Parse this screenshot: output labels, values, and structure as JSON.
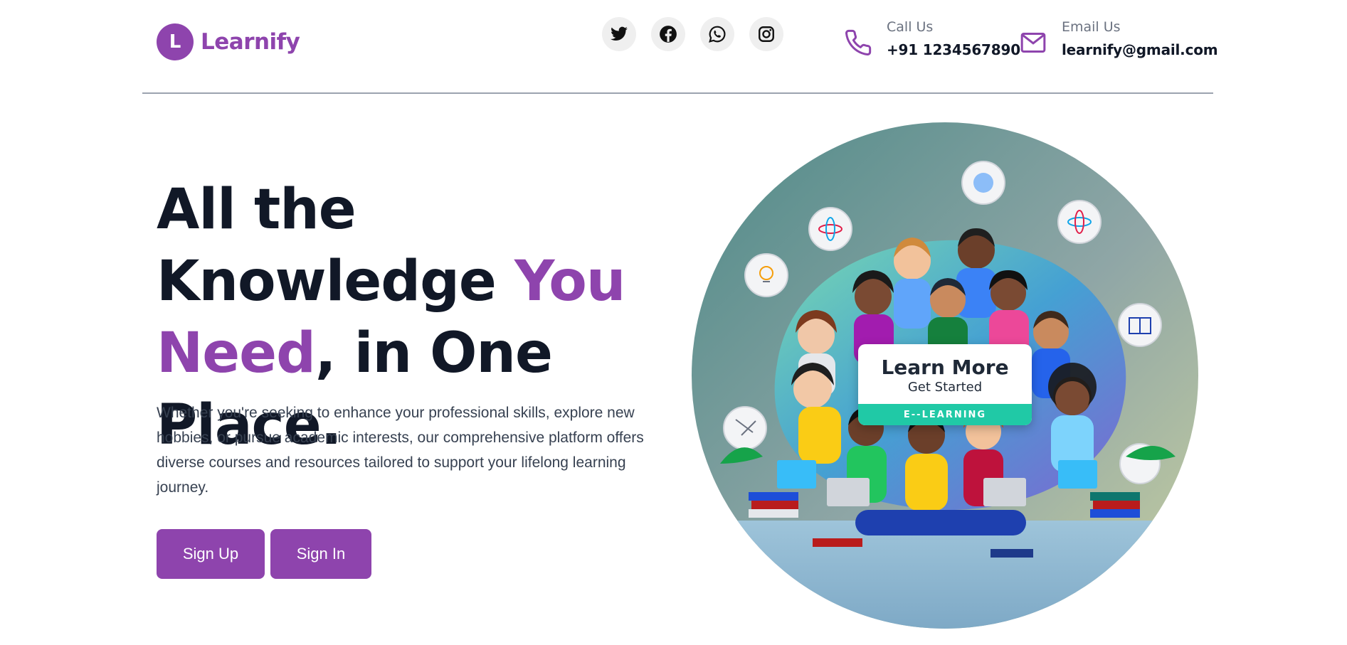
{
  "brand": {
    "logo_letter": "L",
    "name": "Learnify",
    "accent_color": "#8e44ad"
  },
  "socials": [
    {
      "icon": "twitter-icon"
    },
    {
      "icon": "facebook-icon"
    },
    {
      "icon": "whatsapp-icon"
    },
    {
      "icon": "instagram-icon"
    }
  ],
  "contact": {
    "call": {
      "label": "Call Us",
      "value": "+91 1234567890",
      "icon": "phone-icon"
    },
    "email": {
      "label": "Email Us",
      "value": "learnify@gmail.com",
      "icon": "mail-icon"
    }
  },
  "hero": {
    "headline_part1": "All the Knowledge",
    "headline_accent": "You Need",
    "headline_part2": ", in One Place.",
    "description": "Whether you're seeking to enhance your professional skills, explore new hobbies, or pursue academic interests, our comprehensive platform offers diverse courses and resources tailored to support your lifelong learning journey.",
    "signup_label": "Sign Up",
    "signin_label": "Sign In"
  },
  "illustration_card": {
    "title": "Learn More",
    "subtitle": "Get Started",
    "strip": "E--LEARNING",
    "strip_color": "#20c9a6"
  }
}
